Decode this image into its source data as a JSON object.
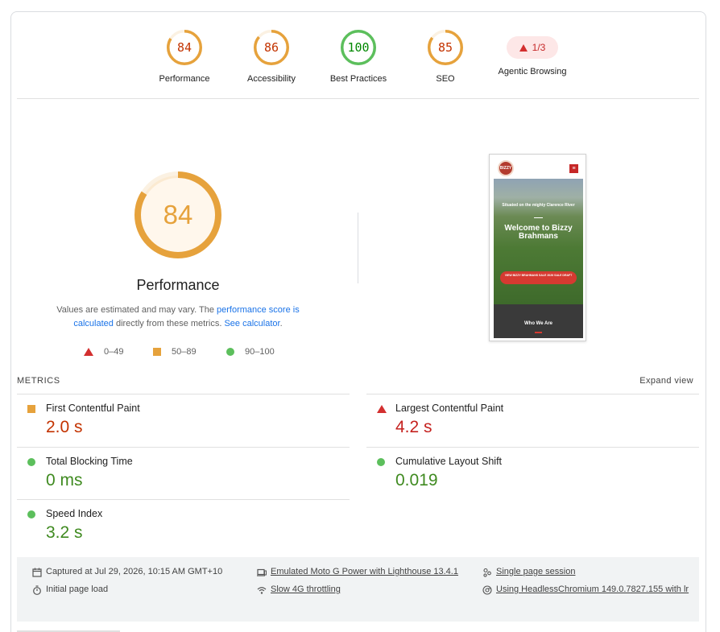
{
  "gauges": {
    "performance": {
      "score": "84",
      "label": "Performance",
      "fraction": 0.84
    },
    "accessibility": {
      "score": "86",
      "label": "Accessibility",
      "fraction": 0.86
    },
    "best_practices": {
      "score": "100",
      "label": "Best Practices",
      "fraction": 1.0
    },
    "seo": {
      "score": "85",
      "label": "SEO",
      "fraction": 0.85
    },
    "agentic": {
      "score": "1/3",
      "label": "Agentic Browsing"
    }
  },
  "colors": {
    "orange": "#e6a23c",
    "green": "#5cbf5c",
    "red": "#d32f2f",
    "link": "#1a73e8"
  },
  "performance_panel": {
    "score": "84",
    "fraction": 0.84,
    "title": "Performance",
    "desc_before": "Values are estimated and may vary. The ",
    "link_score": "performance score is calculated",
    "desc_middle": " directly from these metrics. ",
    "link_calc": "See calculator",
    "desc_after": ".",
    "legend": {
      "fail": "0–49",
      "average": "50–89",
      "pass": "90–100"
    }
  },
  "thumbnail": {
    "logo": "BIZZY",
    "menu_icon": "menu-icon",
    "subtitle": "Situated on the mighty Clarence River",
    "title": "Welcome to Bizzy Brahmans",
    "cta": "VIEW BIZZY BRAHMANS SALE 2026 SALE DRAFT",
    "section": "Who We Are"
  },
  "metrics": {
    "heading": "METRICS",
    "expand": "Expand view",
    "items": [
      {
        "name": "First Contentful Paint",
        "value": "2.0 s",
        "status": "average"
      },
      {
        "name": "Largest Contentful Paint",
        "value": "4.2 s",
        "status": "fail"
      },
      {
        "name": "Total Blocking Time",
        "value": "0 ms",
        "status": "pass"
      },
      {
        "name": "Cumulative Layout Shift",
        "value": "0.019",
        "status": "pass"
      },
      {
        "name": "Speed Index",
        "value": "3.2 s",
        "status": "pass"
      }
    ]
  },
  "info": {
    "captured": "Captured at Jul 29, 2026, 10:15 AM GMT+10",
    "load": "Initial page load",
    "device": "Emulated Moto G Power with Lighthouse 13.4.1",
    "throttle": "Slow 4G throttling",
    "session": "Single page session",
    "browser": "Using HeadlessChromium 149.0.7827.155 with lr"
  }
}
